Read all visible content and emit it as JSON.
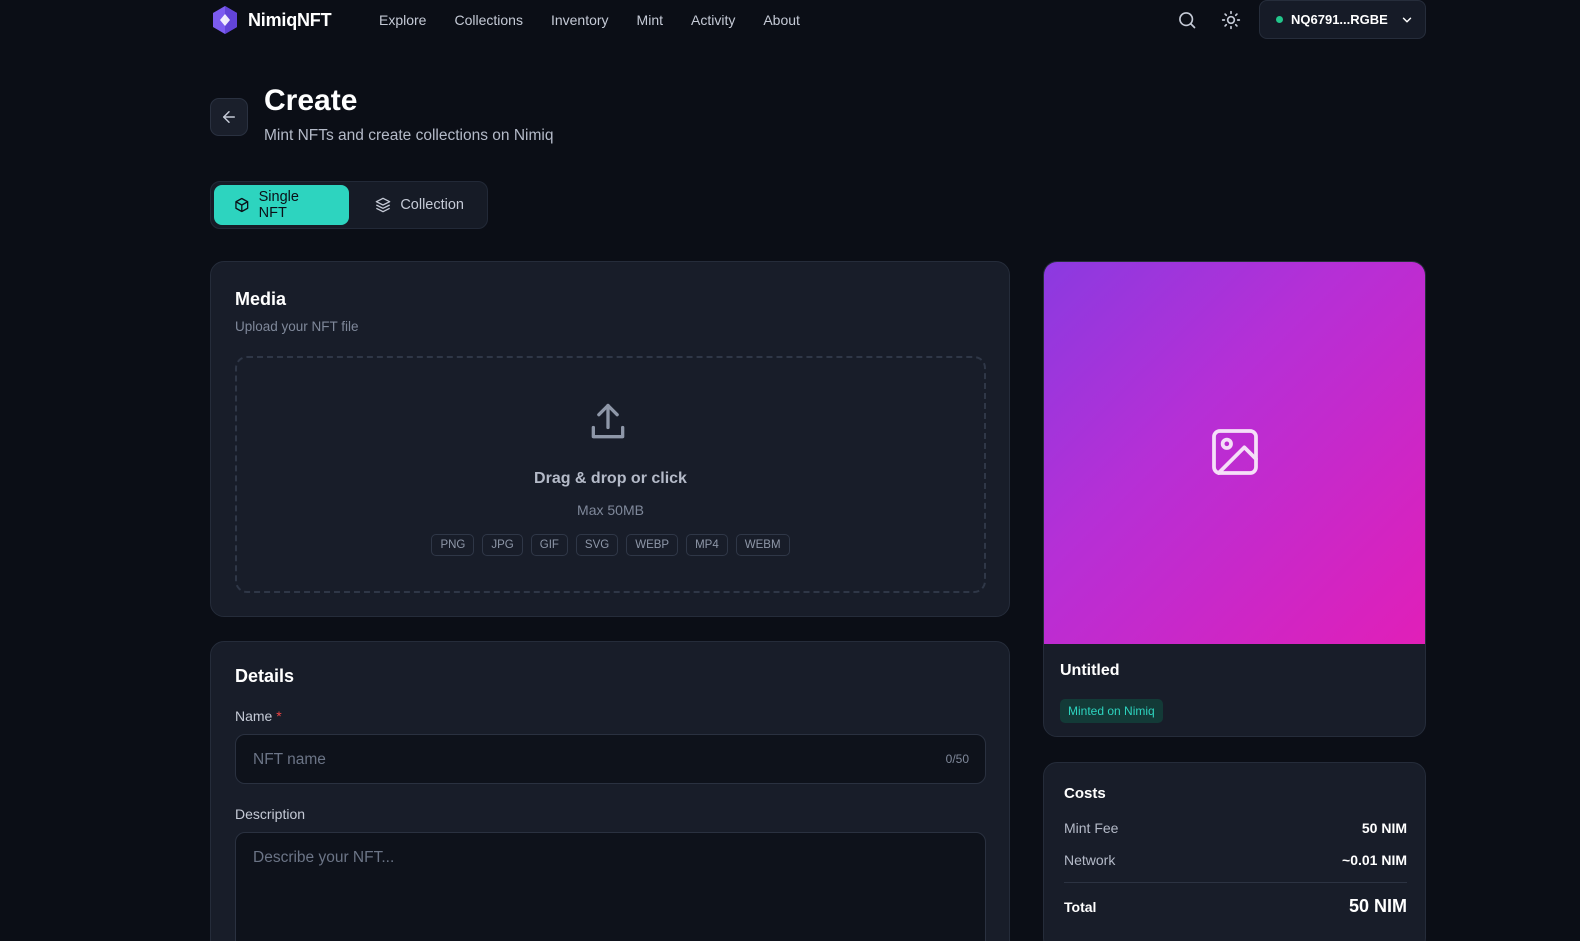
{
  "nav": {
    "brand": "NimiqNFT",
    "links": [
      "Explore",
      "Collections",
      "Inventory",
      "Mint",
      "Activity",
      "About"
    ],
    "wallet_address": "NQ6791...RGBE"
  },
  "header": {
    "title": "Create",
    "subtitle": "Mint NFTs and create collections on Nimiq"
  },
  "tabs": [
    {
      "label": "Single NFT",
      "active": true
    },
    {
      "label": "Collection",
      "active": false
    }
  ],
  "media": {
    "title": "Media",
    "subtitle": "Upload your NFT file",
    "drop_text": "Drag & drop or click",
    "max_size": "Max 50MB",
    "formats": [
      "PNG",
      "JPG",
      "GIF",
      "SVG",
      "WEBP",
      "MP4",
      "WEBM"
    ]
  },
  "details": {
    "title": "Details",
    "name_label": "Name",
    "required_mark": "*",
    "name_placeholder": "NFT name",
    "name_counter": "0/50",
    "description_label": "Description",
    "description_placeholder": "Describe your NFT..."
  },
  "preview": {
    "name": "Untitled",
    "badge": "Minted on Nimiq"
  },
  "costs": {
    "title": "Costs",
    "rows": [
      {
        "label": "Mint Fee",
        "value": "50 NIM"
      },
      {
        "label": "Network",
        "value": "~0.01 NIM"
      }
    ],
    "total_label": "Total",
    "total_value": "50 NIM"
  },
  "colors": {
    "accent": "#2dd4bf",
    "background": "#0b0e16",
    "card": "#181d29",
    "gradient_start": "#8b3ae0",
    "gradient_end": "#e11fb8",
    "wallet_status": "#22c58b"
  },
  "icons": {
    "brand": "hexagon-logo-icon",
    "search": "search-icon",
    "theme": "sun-icon",
    "wallet_menu": "chevron-down-icon",
    "back": "arrow-left-icon",
    "single_tab": "cube-icon",
    "collection_tab": "layers-icon",
    "upload": "upload-icon",
    "preview": "image-icon"
  }
}
